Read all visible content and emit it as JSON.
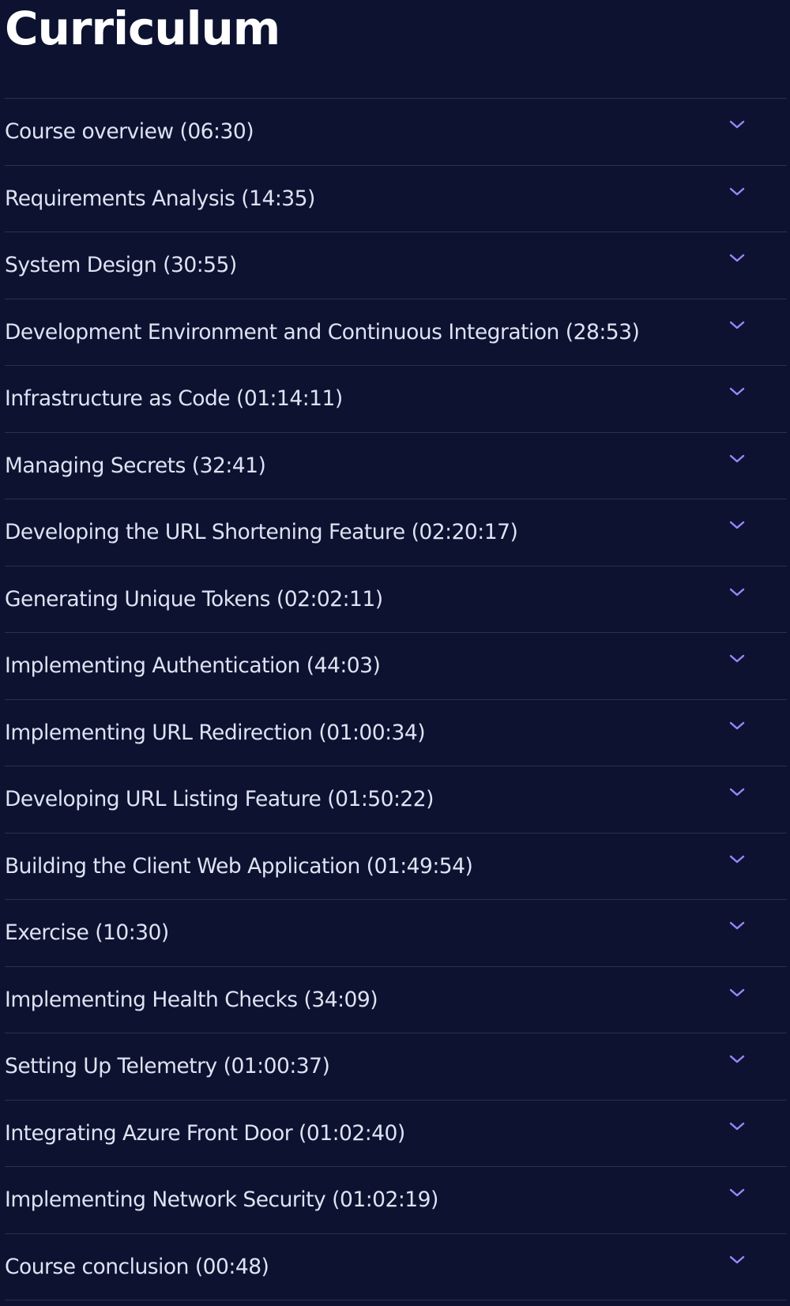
{
  "page": {
    "title": "Curriculum"
  },
  "colors": {
    "background": "#0d1230",
    "text": "#dde3f2",
    "divider": "#2a3050",
    "chevron_accent": "#9b86ff"
  },
  "icons": {
    "expand": "chevron-down-icon"
  },
  "sections": [
    {
      "label": "Course overview (06:30)"
    },
    {
      "label": "Requirements Analysis (14:35)"
    },
    {
      "label": "System Design (30:55)"
    },
    {
      "label": "Development Environment and Continuous Integration (28:53)"
    },
    {
      "label": "Infrastructure as Code (01:14:11)"
    },
    {
      "label": "Managing Secrets (32:41)"
    },
    {
      "label": "Developing the URL Shortening Feature (02:20:17)"
    },
    {
      "label": "Generating Unique Tokens (02:02:11)"
    },
    {
      "label": "Implementing Authentication (44:03)"
    },
    {
      "label": "Implementing URL Redirection (01:00:34)"
    },
    {
      "label": "Developing URL Listing Feature (01:50:22)"
    },
    {
      "label": "Building the Client Web Application (01:49:54)"
    },
    {
      "label": "Exercise (10:30)"
    },
    {
      "label": "Implementing Health Checks (34:09)"
    },
    {
      "label": "Setting Up Telemetry (01:00:37)"
    },
    {
      "label": "Integrating Azure Front Door (01:02:40)"
    },
    {
      "label": "Implementing Network Security (01:02:19)"
    },
    {
      "label": "Course conclusion (00:48)"
    }
  ]
}
